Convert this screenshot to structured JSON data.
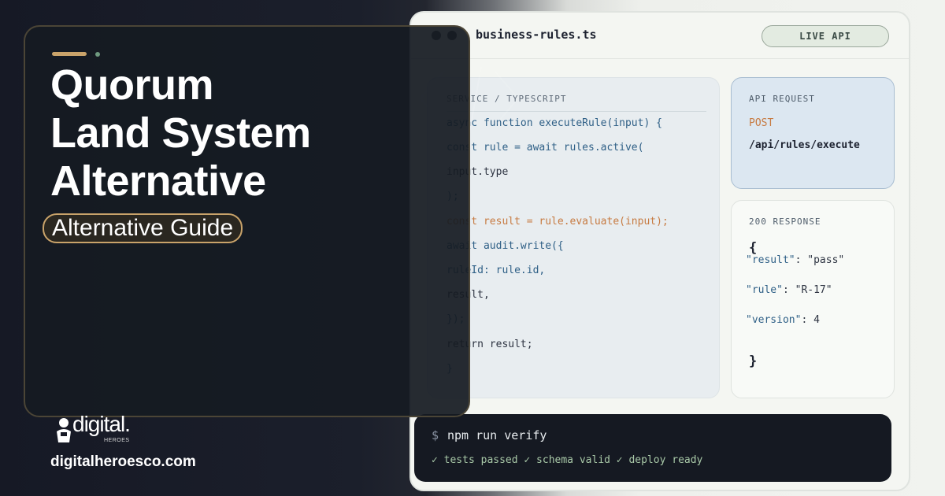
{
  "editor": {
    "filename": "business-rules.ts",
    "live_badge": "LIVE API",
    "code_label": "SERVICE / TYPESCRIPT",
    "code_lines": [
      "async function executeRule(input) {",
      "const rule = await rules.active(",
      "input.type",
      ");",
      "const result = rule.evaluate(input);",
      "await audit.write({",
      "ruleId: rule.id,",
      "result,",
      "});",
      "return result;",
      "}"
    ]
  },
  "api_request": {
    "label": "API REQUEST",
    "method": "POST",
    "path": "/api/rules/execute"
  },
  "api_response": {
    "label": "200 RESPONSE",
    "open_brace": "{",
    "fields": [
      {
        "key": "\"result\"",
        "sep": ": ",
        "value": "\"pass\""
      },
      {
        "key": "\"rule\"",
        "sep": ": ",
        "value": "\"R-17\""
      },
      {
        "key": "\"version\"",
        "sep": ": ",
        "value": "4"
      }
    ],
    "close_brace": "}"
  },
  "terminal": {
    "prompt": "$",
    "command": "npm run verify",
    "output": "✓ tests passed ✓ schema valid ✓ deploy ready"
  },
  "hero": {
    "title_lines": [
      "Quorum",
      "Land System",
      "Alternative"
    ],
    "pill": "Alternative Guide"
  },
  "brand": {
    "logo_text": "digital.",
    "logo_sub": "HEROES",
    "website": "digitalheroesco.com"
  },
  "colors": {
    "accent_gold": "#c9a36a",
    "accent_green": "#6f9a80",
    "code_keyword": "#2e5f86",
    "code_orange": "#c77b42"
  }
}
